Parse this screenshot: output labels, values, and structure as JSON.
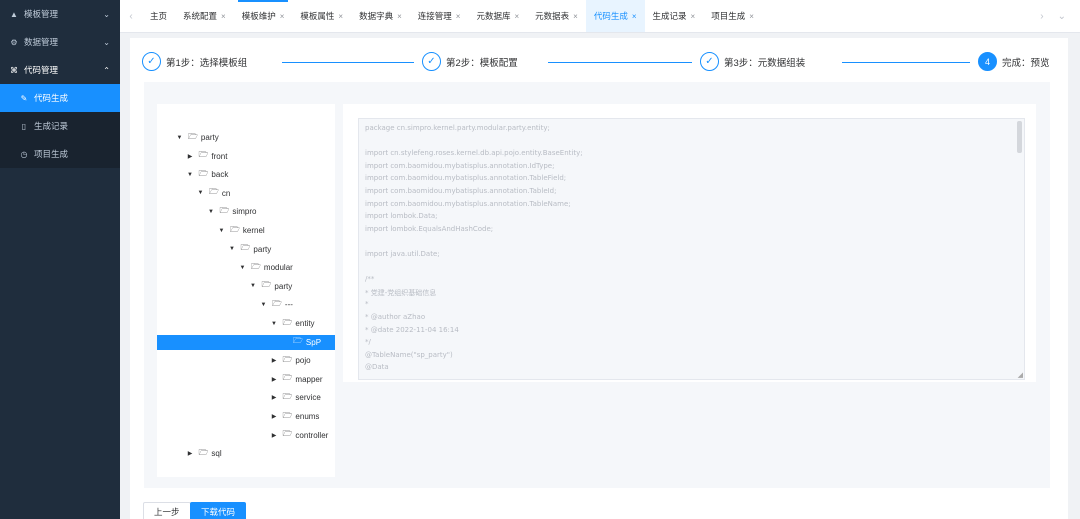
{
  "sidebar": {
    "items": [
      {
        "label": "模板管理",
        "icon": "triangle-icon",
        "expanded": false
      },
      {
        "label": "数据管理",
        "icon": "gear-icon",
        "expanded": false
      },
      {
        "label": "代码管理",
        "icon": "code-icon",
        "expanded": true
      }
    ],
    "sub_items": [
      {
        "label": "代码生成",
        "icon": "edit-icon",
        "active": true
      },
      {
        "label": "生成记录",
        "icon": "document-icon",
        "active": false
      },
      {
        "label": "项目生成",
        "icon": "clock-icon",
        "active": false
      }
    ]
  },
  "tabs": [
    {
      "label": "主页",
      "closable": false
    },
    {
      "label": "系统配置",
      "closable": true
    },
    {
      "label": "模板维护",
      "closable": true
    },
    {
      "label": "模板属性",
      "closable": true
    },
    {
      "label": "数据字典",
      "closable": true
    },
    {
      "label": "连接管理",
      "closable": true
    },
    {
      "label": "元数据库",
      "closable": true
    },
    {
      "label": "元数据表",
      "closable": true
    },
    {
      "label": "代码生成",
      "closable": true,
      "active": true
    },
    {
      "label": "生成记录",
      "closable": true
    },
    {
      "label": "项目生成",
      "closable": true
    }
  ],
  "tab_close_glyph": "×",
  "steps": [
    {
      "label": "第1步：选择模板组",
      "marker": "✓",
      "status": "done"
    },
    {
      "label": "第2步：模板配置",
      "marker": "✓",
      "status": "done"
    },
    {
      "label": "第3步：元数据组装",
      "marker": "✓",
      "status": "done"
    },
    {
      "label": "完成：预览",
      "marker": "4",
      "status": "current"
    }
  ],
  "tree": [
    {
      "label": "party",
      "depth": 0,
      "expanded": true
    },
    {
      "label": "front",
      "depth": 1,
      "expanded": false
    },
    {
      "label": "back",
      "depth": 1,
      "expanded": true
    },
    {
      "label": "cn",
      "depth": 2,
      "expanded": true
    },
    {
      "label": "simpro",
      "depth": 3,
      "expanded": true
    },
    {
      "label": "kernel",
      "depth": 4,
      "expanded": true
    },
    {
      "label": "party",
      "depth": 5,
      "expanded": true
    },
    {
      "label": "modular",
      "depth": 6,
      "expanded": true
    },
    {
      "label": "party",
      "depth": 7,
      "expanded": true
    },
    {
      "label": "---",
      "depth": 8,
      "expanded": true
    },
    {
      "label": "entity",
      "depth": 9,
      "expanded": true
    },
    {
      "label": "SpP",
      "depth": 10,
      "leaf": true,
      "selected": true
    },
    {
      "label": "pojo",
      "depth": 9,
      "expanded": false
    },
    {
      "label": "mapper",
      "depth": 9,
      "expanded": false
    },
    {
      "label": "service",
      "depth": 9,
      "expanded": false
    },
    {
      "label": "enums",
      "depth": 9,
      "expanded": false
    },
    {
      "label": "controller",
      "depth": 9,
      "expanded": false
    },
    {
      "label": "sql",
      "depth": 1,
      "expanded": false
    }
  ],
  "code_lines": [
    "package cn.simpro.kernel.party.modular.party.entity;",
    "",
    "import cn.stylefeng.roses.kernel.db.api.pojo.entity.BaseEntity;",
    "import com.baomidou.mybatisplus.annotation.IdType;",
    "import com.baomidou.mybatisplus.annotation.TableField;",
    "import com.baomidou.mybatisplus.annotation.TableId;",
    "import com.baomidou.mybatisplus.annotation.TableName;",
    "import lombok.Data;",
    "import lombok.EqualsAndHashCode;",
    "",
    "import java.util.Date;",
    "",
    "/**",
    " * 党建-党组织基础信息",
    " *",
    " * @author aZhao",
    " * @date 2022-11-04 16:14",
    " */",
    "@TableName(\"sp_party\")",
    "@Data"
  ],
  "buttons": {
    "prev": "上一步",
    "download": "下载代码"
  },
  "colors": {
    "primary": "#1890ff",
    "sidebar_bg": "#1f2d3d"
  }
}
